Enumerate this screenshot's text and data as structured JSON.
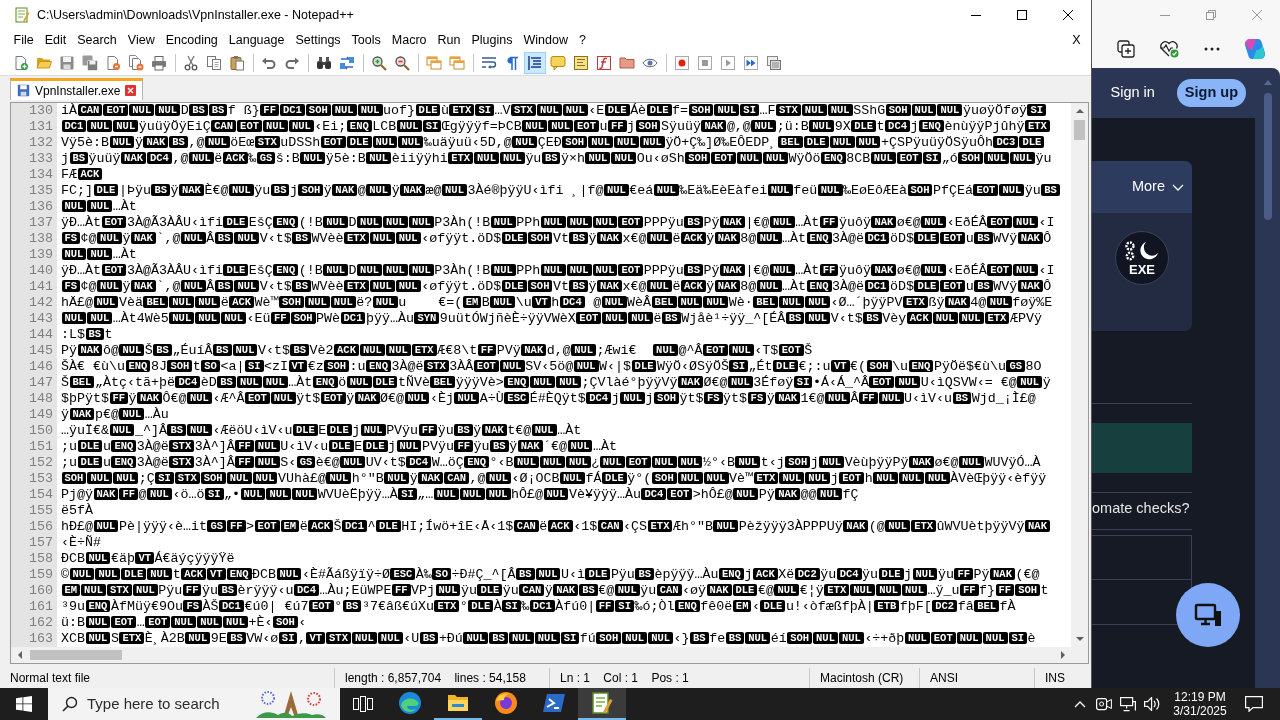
{
  "window": {
    "title": "C:\\Users\\admin\\Downloads\\VpnInstaller.exe - Notepad++"
  },
  "menu": [
    "File",
    "Edit",
    "Search",
    "View",
    "Encoding",
    "Language",
    "Settings",
    "Tools",
    "Macro",
    "Run",
    "Plugins",
    "Window",
    "?"
  ],
  "menu_close": "X",
  "toolbar": [
    [
      {
        "pressed": false
      },
      {
        "pressed": false
      },
      {
        "pressed": false
      },
      {
        "pressed": false
      },
      {
        "pressed": false
      },
      {
        "pressed": false
      },
      {
        "pressed": false
      }
    ],
    [
      {
        "pressed": false
      },
      {
        "pressed": false
      },
      {
        "pressed": false
      }
    ],
    [
      {
        "pressed": false
      },
      {
        "pressed": false
      }
    ],
    [
      {
        "pressed": false
      },
      {
        "pressed": false
      }
    ],
    [
      {
        "pressed": false
      },
      {
        "pressed": false
      }
    ],
    [
      {
        "pressed": false
      },
      {
        "pressed": false
      }
    ],
    [
      {
        "pressed": false
      },
      {
        "pressed": false
      },
      {
        "pressed": true
      },
      {
        "pressed": false
      },
      {
        "pressed": false
      },
      {
        "pressed": false
      },
      {
        "pressed": false
      },
      {
        "pressed": false
      }
    ],
    [
      {
        "pressed": false
      },
      {
        "pressed": false
      },
      {
        "pressed": false
      },
      {
        "pressed": false
      },
      {
        "pressed": false
      }
    ]
  ],
  "tabs": [
    {
      "label": "VpnInstaller.exe",
      "selected": true
    }
  ],
  "editor": {
    "lines": [
      {
        "number": "130",
        "parts": [
          "iÀ",
          [
            "CAN",
            "EOT",
            "NUL",
            "NUL"
          ],
          "D",
          [
            "BS",
            "BS"
          ],
          "f ß}",
          [
            "FF",
            "DC1",
            "SOH",
            "NUL",
            "NUL"
          ],
          "uof}",
          [
            "DLE"
          ],
          "ù",
          [
            "ETX",
            "SI"
          ],
          "…V",
          [
            "STX",
            "NUL",
            "NUL"
          ],
          "‹E",
          [
            "DLE"
          ],
          "Áè",
          [
            "DLE"
          ],
          "f=",
          [
            "SOH",
            "NUL",
            "SI"
          ],
          "…F",
          [
            "STX",
            "NUL",
            "NUL"
          ],
          "SShG",
          [
            "SOH",
            "NUL",
            "NUL"
          ],
          "ÿuøÿÖføÿ",
          [
            "SI"
          ]
        ]
      },
      {
        "number": "131",
        "parts": [
          [
            "DC1",
            "NUL",
            "NUL"
          ],
          "ÿuüÿÖÿEiÇ",
          [
            "CAN",
            "EOT",
            "NUL",
            "NUL"
          ],
          "‹Ei;",
          [
            "ENQ"
          ],
          "LCB",
          [
            "NUL",
            "SI"
          ],
          "Œgÿÿÿf=ÞCB",
          [
            "NUL",
            "NUL",
            "EOT"
          ],
          "u",
          [
            "FF"
          ],
          "j",
          [
            "SOH"
          ],
          "Sÿuüÿ",
          [
            "NAK"
          ],
          "@,@",
          [
            "NUL"
          ],
          ";ü:B",
          [
            "NUL"
          ],
          "9X",
          [
            "DLE"
          ],
          "t",
          [
            "DC4"
          ],
          "j",
          [
            "ENQ"
          ],
          "ènùÿÿPjûhÿ",
          [
            "ETX"
          ]
        ]
      },
      {
        "number": "132",
        "parts": [
          "Vÿ5è:B",
          [
            "NUL"
          ],
          "ÿ",
          [
            "NAK",
            "BS"
          ],
          ",@",
          [
            "NUL"
          ],
          "öEœ",
          [
            "STX"
          ],
          "uDSSh",
          [
            "EOT",
            "DLE",
            "NUL",
            "NUL"
          ],
          "‰uäÿuü‹5D,@",
          [
            "NUL"
          ],
          "ÇEÐ",
          [
            "SOH",
            "NUL",
            "NUL",
            "NUL"
          ],
          "ÿÖ+Ç‰]Ø‰EÔEDP¸",
          [
            "BEL",
            "DLE",
            "NUL",
            "NUL"
          ],
          "+ÇSPÿuüÿÖSÿuÔh",
          [
            "DC3",
            "DLE"
          ]
        ]
      },
      {
        "number": "133",
        "parts": [
          "j",
          [
            "BS"
          ],
          "ÿuüÿ",
          [
            "NAK",
            "DC4"
          ],
          ",@",
          [
            "NUL"
          ],
          "ë",
          [
            "ACK"
          ],
          "‰",
          [
            "GS"
          ],
          "š:B",
          [
            "NUL"
          ],
          "ÿ5è:B",
          [
            "NUL"
          ],
          "èiiÿÿhi",
          [
            "ETX",
            "NUL",
            "NUL"
          ],
          "ÿu",
          [
            "BS"
          ],
          "ÿ×h",
          [
            "NUL",
            "NUL"
          ],
          "Ou‹øSh",
          [
            "SOH",
            "EOT",
            "NUL",
            "NUL"
          ],
          "WÿÖö",
          [
            "ENQ"
          ],
          "8CB",
          [
            "NUL",
            "EOT",
            "SI"
          ],
          "„ó",
          [
            "SOH",
            "NUL",
            "NUL"
          ],
          "ÿu"
        ]
      },
      {
        "number": "134",
        "parts": [
          "FÆ",
          [
            "ACK"
          ]
        ]
      },
      {
        "number": "135",
        "parts": [
          "FC;]",
          [
            "DLE"
          ],
          "|Þÿu",
          [
            "BS"
          ],
          "ÿ",
          [
            "NAK"
          ],
          "È€@",
          [
            "NUL"
          ],
          "ÿu",
          [
            "BS"
          ],
          "j",
          [
            "SOH"
          ],
          "ÿ",
          [
            "NAK"
          ],
          "@",
          [
            "NUL"
          ],
          "ÿ",
          [
            "NAK"
          ],
          "æ@",
          [
            "NUL"
          ],
          "3Àé®þÿÿU‹ìfi ¸|f@",
          [
            "NUL"
          ],
          "€eá",
          [
            "NUL"
          ],
          "‰Eä‰EèEàfei",
          [
            "NUL"
          ],
          "feü",
          [
            "NUL"
          ],
          "‰EøEôÆEà",
          [
            "SOH"
          ],
          "PfÇEá",
          [
            "EOT",
            "NUL"
          ],
          "ÿu",
          [
            "BS"
          ]
        ]
      },
      {
        "number": "136",
        "parts": [
          [
            "NUL",
            "NUL"
          ],
          "…Àt"
        ]
      },
      {
        "number": "137",
        "parts": [
          "ÿÐ…Àt",
          [
            "EOT"
          ],
          "3À@Ã3ÀÂU‹ìfi",
          [
            "DLE"
          ],
          "EšÇ",
          [
            "ENQ"
          ],
          "(!B",
          [
            "NUL"
          ],
          "D",
          [
            "NUL",
            "NUL",
            "NUL"
          ],
          "P3Àh(!B",
          [
            "NUL"
          ],
          "PPh",
          [
            "NUL",
            "NUL",
            "NUL",
            "EOT"
          ],
          "PPPÿu",
          [
            "BS"
          ],
          "Pÿ",
          [
            "NAK"
          ],
          "|€@",
          [
            "NUL"
          ],
          "…Àt",
          [
            "FF"
          ],
          "ÿuôÿ",
          [
            "NAK"
          ],
          "ø€@",
          [
            "NUL"
          ],
          "‹EðÉÂ",
          [
            "EOT",
            "NUL"
          ],
          "‹I"
        ]
      },
      {
        "number": "138",
        "parts": [
          [
            "FS"
          ],
          "¢@",
          [
            "NUL"
          ],
          "ÿ",
          [
            "NAK"
          ],
          "`,@",
          [
            "NUL"
          ],
          "Â",
          [
            "BS",
            "NUL"
          ],
          "V‹t$",
          [
            "BS"
          ],
          "WVèè",
          [
            "ETX",
            "NUL",
            "NUL"
          ],
          "‹øfÿÿt.öD$",
          [
            "DLE",
            "SOH"
          ],
          "Vt",
          [
            "BS"
          ],
          "ÿ",
          [
            "NAK"
          ],
          "x€@",
          [
            "NUL"
          ],
          "ë",
          [
            "ACK"
          ],
          "ÿ",
          [
            "NAK"
          ],
          "8@",
          [
            "NUL"
          ],
          "…Àt",
          [
            "ENQ"
          ],
          "3À@ë",
          [
            "DC1"
          ],
          "öD$",
          [
            "DLE",
            "EOT"
          ],
          "u",
          [
            "BS"
          ],
          "WVÿ",
          [
            "NAK"
          ],
          "Ô"
        ]
      },
      {
        "number": "139",
        "parts": [
          [
            "NUL",
            "NUL"
          ],
          "…Àt"
        ]
      },
      {
        "number": "140",
        "parts": [
          "ÿÐ…Àt",
          [
            "EOT"
          ],
          "3À@Ã3ÀÂU‹ìfi",
          [
            "DLE"
          ],
          "EšÇ",
          [
            "ENQ"
          ],
          "(!B",
          [
            "NUL"
          ],
          "D",
          [
            "NUL",
            "NUL",
            "NUL"
          ],
          "P3Àh(!B",
          [
            "NUL"
          ],
          "PPh",
          [
            "NUL",
            "NUL",
            "NUL",
            "EOT"
          ],
          "PPPÿu",
          [
            "BS"
          ],
          "Pÿ",
          [
            "NAK"
          ],
          "|€@",
          [
            "NUL"
          ],
          "…Àt",
          [
            "FF"
          ],
          "ÿuôÿ",
          [
            "NAK"
          ],
          "ø€@",
          [
            "NUL"
          ],
          "‹EðÉÂ",
          [
            "EOT",
            "NUL"
          ],
          "‹I"
        ]
      },
      {
        "number": "141",
        "parts": [
          [
            "FS"
          ],
          "¢@",
          [
            "NUL"
          ],
          "ÿ",
          [
            "NAK"
          ],
          "`,@",
          [
            "NUL"
          ],
          "Â",
          [
            "BS",
            "NUL"
          ],
          "V‹t$",
          [
            "BS"
          ],
          "WVèè",
          [
            "ETX",
            "NUL",
            "NUL"
          ],
          "‹øfÿÿt.öD$",
          [
            "DLE",
            "SOH"
          ],
          "Vt",
          [
            "BS"
          ],
          "ÿ",
          [
            "NAK"
          ],
          "x€@",
          [
            "NUL"
          ],
          "ë",
          [
            "ACK"
          ],
          "ÿ",
          [
            "NAK"
          ],
          "8@",
          [
            "NUL"
          ],
          "…Àt",
          [
            "ENQ"
          ],
          "3À@ë",
          [
            "DC1"
          ],
          "öD$",
          [
            "DLE",
            "EOT"
          ],
          "u",
          [
            "BS"
          ],
          "WVÿ",
          [
            "NAK"
          ],
          "Ô"
        ]
      },
      {
        "number": "142",
        "parts": [
          "hÄ£@",
          [
            "NUL"
          ],
          "Vèä",
          [
            "BEL",
            "NUL",
            "NUL"
          ],
          "ë",
          [
            "ACK"
          ],
          "Wè™",
          [
            "SOH",
            "NUL",
            "NUL"
          ],
          "ë?",
          [
            "NUL"
          ],
          "u    €=(",
          [
            "EM"
          ],
          "B",
          [
            "NUL"
          ],
          "\\u",
          [
            "VT"
          ],
          "h",
          [
            "DC4"
          ],
          " @",
          [
            "NUL"
          ],
          "WèÂ",
          [
            "BEL",
            "NUL",
            "NUL"
          ],
          "Wè·",
          [
            "BEL",
            "NUL",
            "NUL"
          ],
          "‹Ø…´þÿÿPV",
          [
            "ETX"
          ],
          "ßÿ",
          [
            "NAK"
          ],
          "4@",
          [
            "NUL"
          ],
          "føÿ%E"
        ]
      },
      {
        "number": "143",
        "parts": [
          [
            "NUL",
            "NUL"
          ],
          "…Àt4Wè5",
          [
            "NUL",
            "NUL",
            "NUL"
          ],
          "‹Eü",
          [
            "FF",
            "SOH"
          ],
          "PWè",
          [
            "DC1"
          ],
          "þÿÿ…Àu",
          [
            "SYN"
          ],
          "9uütÓWjñèÈ÷ÿÿVWèX",
          [
            "EOT",
            "NUL",
            "NUL"
          ],
          "ë",
          [
            "BS"
          ],
          "Wjåè¹÷ÿÿ_^[ÉÂ",
          [
            "BS",
            "NUL"
          ],
          "V‹t$",
          [
            "BS"
          ],
          "Vèy",
          [
            "ACK",
            "NUL",
            "NUL",
            "ETX"
          ],
          "ÆPVÿ"
        ]
      },
      {
        "number": "144",
        "parts": [
          ":L$",
          [
            "BS"
          ],
          "t"
        ]
      },
      {
        "number": "145",
        "parts": [
          "Pÿ",
          [
            "NAK"
          ],
          "ô@",
          [
            "NUL"
          ],
          "Š",
          [
            "BS"
          ],
          "„ÉuíÂ",
          [
            "BS",
            "NUL"
          ],
          "V‹t$",
          [
            "BS"
          ],
          "Vè2",
          [
            "ACK",
            "NUL",
            "NUL",
            "ETX"
          ],
          "Æ€8\\t",
          [
            "FF"
          ],
          "PVÿ",
          [
            "NAK"
          ],
          "d,@",
          [
            "NUL"
          ],
          ";Æwi€  ",
          [
            "NUL"
          ],
          "@^Â",
          [
            "EOT",
            "NUL"
          ],
          "‹T$",
          [
            "EOT"
          ],
          "Š"
        ]
      },
      {
        "number": "146",
        "parts": [
          "ŠÀ€ €ù\\u",
          [
            "ENQ"
          ],
          "8J",
          [
            "SOH"
          ],
          "t",
          [
            "SO"
          ],
          "<a|",
          [
            "SI"
          ],
          "<zI",
          [
            "VT"
          ],
          "€z",
          [
            "SOH"
          ],
          ":u",
          [
            "ENQ"
          ],
          "3À@ë",
          [
            "STX"
          ],
          "3ÀÂ",
          [
            "EOT",
            "NUL"
          ],
          "SV‹5ö@",
          [
            "NUL"
          ],
          "W‹|$",
          [
            "DLE"
          ],
          "WÿÖ‹ØSÿÖŠ",
          [
            "SI"
          ],
          "„Ét",
          [
            "DLE"
          ],
          "€;:u",
          [
            "VT"
          ],
          "€(",
          [
            "SOH"
          ],
          "\\u",
          [
            "ENQ"
          ],
          "PÿÖë$€ù\\u",
          [
            "GS"
          ],
          "8O"
        ]
      },
      {
        "number": "147",
        "parts": [
          "Š",
          [
            "BEL"
          ],
          "„Àtç‹tã+þë",
          [
            "DC4"
          ],
          "èD",
          [
            "BS",
            "NUL",
            "NUL"
          ],
          "…Àt",
          [
            "ENQ"
          ],
          "ö",
          [
            "NUL",
            "DLE"
          ],
          "tÑVè",
          [
            "BEL"
          ],
          "ÿÿÿVè>",
          [
            "ENQ",
            "NUL",
            "NUL"
          ],
          ";ÇVlàé°þÿÿVÿ",
          [
            "NAK"
          ],
          "Ø€@",
          [
            "NUL"
          ],
          "3Éføÿ",
          [
            "SI"
          ],
          "•Á‹Á_^Â",
          [
            "EOT",
            "NUL"
          ],
          "U‹ìQSVW‹= €@",
          [
            "NUL"
          ],
          "ÿ"
        ]
      },
      {
        "number": "148",
        "parts": [
          "$þPÿt$",
          [
            "FF"
          ],
          "ÿ",
          [
            "NAK"
          ],
          "Ô€@",
          [
            "NUL"
          ],
          "‹Æ^Â",
          [
            "EOT",
            "NUL"
          ],
          "ÿt$",
          [
            "EOT"
          ],
          "ÿ",
          [
            "NAK"
          ],
          "Ø€@",
          [
            "NUL"
          ],
          "‹Èj",
          [
            "NUL"
          ],
          "A÷Ù",
          [
            "ESC"
          ],
          "É#ÈQÿt$",
          [
            "DC4"
          ],
          "j",
          [
            "NUL"
          ],
          "j",
          [
            "SOH"
          ],
          "ÿt$",
          [
            "FS"
          ],
          "ÿt$",
          [
            "FS"
          ],
          "ÿ",
          [
            "NAK"
          ],
          "1€@",
          [
            "NUL"
          ],
          "Â",
          [
            "FF",
            "NUL"
          ],
          "U‹ìV‹u",
          [
            "BS"
          ],
          "Wjd_¡Ì£@"
        ]
      },
      {
        "number": "149",
        "parts": [
          "ÿ",
          [
            "NAK"
          ],
          "p€@",
          [
            "NUL"
          ],
          "…Àu"
        ]
      },
      {
        "number": "150",
        "parts": [
          "…ÿuÏ€&",
          [
            "NUL"
          ],
          "_^]Â",
          [
            "BS",
            "NUL"
          ],
          "‹ÆëöU‹ìV‹u",
          [
            "DLE"
          ],
          "E",
          [
            "DLE"
          ],
          "j",
          [
            "NUL"
          ],
          "PVÿu",
          [
            "FF"
          ],
          "ÿu",
          [
            "BS"
          ],
          "ÿ",
          [
            "NAK"
          ],
          "t€@",
          [
            "NUL"
          ],
          "…Àt"
        ]
      },
      {
        "number": "151",
        "parts": [
          ";u",
          [
            "DLE"
          ],
          "u",
          [
            "ENQ"
          ],
          "3À@ë",
          [
            "STX"
          ],
          "3À^]Â",
          [
            "FF",
            "NUL"
          ],
          "U‹ìV‹u",
          [
            "DLE"
          ],
          "E",
          [
            "DLE"
          ],
          "j",
          [
            "NUL"
          ],
          "PVÿu",
          [
            "FF"
          ],
          "ÿu",
          [
            "BS"
          ],
          "ÿ",
          [
            "NAK"
          ],
          "´€@",
          [
            "NUL"
          ],
          "…Àt"
        ]
      },
      {
        "number": "152",
        "parts": [
          ";u",
          [
            "DLE"
          ],
          "u",
          [
            "ENQ"
          ],
          "3À@ë",
          [
            "STX"
          ],
          "3À^]Â",
          [
            "FF",
            "NUL"
          ],
          "S‹",
          [
            "GS"
          ],
          "è€@",
          [
            "NUL"
          ],
          "UV‹t$",
          [
            "DC4"
          ],
          "W…öÇ",
          [
            "ENQ"
          ],
          "°‹B",
          [
            "NUL",
            "NUL",
            "NUL"
          ],
          "¿",
          [
            "NUL",
            "EOT",
            "NUL",
            "NUL"
          ],
          "½°‹B",
          [
            "NUL"
          ],
          "t‹j",
          [
            "SOH"
          ],
          "j",
          [
            "NUL"
          ],
          "VèùþÿÿPÿ",
          [
            "NAK"
          ],
          "ø€@",
          [
            "NUL"
          ],
          "WUVÿÓ…À"
        ]
      },
      {
        "number": "153",
        "parts": [
          [
            "SOH",
            "NUL",
            "NUL"
          ],
          ";Ç",
          [
            "SI",
            "STX",
            "SOH",
            "NUL",
            "NUL"
          ],
          "VUhà£@",
          [
            "NUL"
          ],
          "h°\"B",
          [
            "NUL"
          ],
          "ÿ",
          [
            "NAK",
            "CAN"
          ],
          ",@",
          [
            "NUL"
          ],
          "‹Ø¡OCB",
          [
            "NUL"
          ],
          "fÁ",
          [
            "DLE"
          ],
          "ÿ°(",
          [
            "SOH",
            "NUL",
            "NUL"
          ],
          "Vè™",
          [
            "ETX",
            "NUL",
            "NUL"
          ],
          "j",
          [
            "EOT"
          ],
          "h",
          [
            "NUL",
            "NUL",
            "NUL"
          ],
          "ÀVèŒþÿÿ‹èfÿÿ"
        ]
      },
      {
        "number": "154",
        "parts": [
          "Pj@ÿ",
          [
            "NAK",
            "FF"
          ],
          "@",
          [
            "NUL"
          ],
          "‹ö…ö",
          [
            "SI"
          ],
          "„•",
          [
            "NUL",
            "NUL",
            "NUL"
          ],
          "WVUèËþÿÿ…À",
          [
            "SI"
          ],
          "„…",
          [
            "NUL",
            "NUL",
            "NUL"
          ],
          "hÔ£@",
          [
            "NUL"
          ],
          "Vè¥ÿÿÿ…Àu",
          [
            "DC4",
            "EOT"
          ],
          ">hÔ£@",
          [
            "NUL"
          ],
          "Pÿ",
          [
            "NAK"
          ],
          "@@",
          [
            "NUL"
          ],
          "fÇ"
        ]
      },
      {
        "number": "155",
        "parts": [
          "ë5fÀ"
        ]
      },
      {
        "number": "156",
        "parts": [
          "hÐ£@",
          [
            "NUL"
          ],
          "Pè|ÿÿÿ‹è…it",
          [
            "GS",
            "FF"
          ],
          ">",
          [
            "EOT",
            "EM"
          ],
          "ë",
          [
            "ACK"
          ],
          "Š",
          [
            "DC1"
          ],
          "^",
          [
            "DLE"
          ],
          "HI;Íwö+îE‹Å‹1$",
          [
            "CAN"
          ],
          "ë",
          [
            "ACK"
          ],
          "‹1$",
          [
            "CAN"
          ],
          "‹ÇS",
          [
            "ETX"
          ],
          "Æh°\"B",
          [
            "NUL"
          ],
          "Pèžÿÿÿ3ÀPPPUÿ",
          [
            "NAK"
          ],
          "(@",
          [
            "NUL",
            "ETX"
          ],
          "ûWVUètþÿÿVÿ",
          [
            "NAK"
          ]
        ]
      },
      {
        "number": "157",
        "parts": [
          "‹È÷Ñ#"
        ]
      },
      {
        "number": "158",
        "parts": [
          "ÐCB",
          [
            "NUL"
          ],
          "€äþ",
          [
            "VT"
          ],
          "Á€äýçÿÿÿŸë"
        ]
      },
      {
        "number": "159",
        "parts": [
          "©",
          [
            "NUL",
            "NUL",
            "DLE",
            "NUL"
          ],
          "t",
          [
            "ACK",
            "VT",
            "ENQ"
          ],
          "ÐCB",
          [
            "NUL"
          ],
          "‹È#Ãáßÿïÿ÷Ø",
          [
            "ESC"
          ],
          "À‰",
          [
            "SO"
          ],
          "÷Ð#Ç_^[Â",
          [
            "BS",
            "NUL"
          ],
          "U‹ì",
          [
            "DLE"
          ],
          "Pÿu",
          [
            "BS"
          ],
          "èpÿÿÿ…Àu",
          [
            "ENQ"
          ],
          "j",
          [
            "ACK"
          ],
          "Xë",
          [
            "DC2"
          ],
          "ÿu",
          [
            "DC4"
          ],
          "ÿu",
          [
            "DLE"
          ],
          "j",
          [
            "NUL"
          ],
          "ÿu",
          [
            "FF"
          ],
          "Pÿ",
          [
            "NAK"
          ],
          "(€@"
        ]
      },
      {
        "number": "160",
        "parts": [
          [
            "EM",
            "NUL",
            "STX",
            "NUL"
          ],
          "Pÿu",
          [
            "FF"
          ],
          "ÿu",
          [
            "BS"
          ],
          "èrÿÿÿ‹u",
          [
            "DC4"
          ],
          "…Àu;EüWPE",
          [
            "FF"
          ],
          "VPj",
          [
            "NUL"
          ],
          "ÿu",
          [
            "DLE"
          ],
          "ÿu",
          [
            "CAN"
          ],
          "ÿ",
          [
            "NAK",
            "BS"
          ],
          "€@",
          [
            "NUL"
          ],
          "ÿu",
          [
            "CAN"
          ],
          "‹øÿ",
          [
            "NAK",
            "DLE"
          ],
          "€@",
          [
            "NUL"
          ],
          "€¦ÿ",
          [
            "ETX",
            "NUL",
            "NUL",
            "NUL"
          ],
          "…ÿ_u",
          [
            "FF"
          ],
          "f}",
          [
            "FF",
            "SOH"
          ],
          "t"
        ]
      },
      {
        "number": "161",
        "parts": [
          "³9u",
          [
            "ENQ"
          ],
          "ÀfMüÿ€9Ou",
          [
            "FS"
          ],
          "ÀŠ",
          [
            "DC1"
          ],
          "€ú0| €ú7",
          [
            "EOT"
          ],
          "°",
          [
            "BS"
          ],
          "³7€âß€úXu",
          [
            "ETX"
          ],
          "°",
          [
            "DLE"
          ],
          "À",
          [
            "SI"
          ],
          "‰",
          [
            "DC1"
          ],
          "Àfú0|",
          [
            "FF",
            "SI"
          ],
          "‰ó;Òl",
          [
            "ENQ"
          ],
          "fê0ë",
          [
            "EM"
          ],
          "‹",
          [
            "DLE"
          ],
          "u!‹òfæßfþÀ|",
          [
            "ETB"
          ],
          "fþF[",
          [
            "DC2"
          ],
          "fâ",
          [
            "BEL"
          ],
          "fÀ"
        ]
      },
      {
        "number": "162",
        "parts": [
          "ü:B",
          [
            "NUL",
            "EOT"
          ],
          "…",
          [
            "EOT",
            "NUL",
            "NUL",
            "NUL"
          ],
          "+È‹",
          [
            "SOH"
          ],
          "‹"
        ]
      },
      {
        "number": "163",
        "parts": [
          "XCB",
          [
            "NUL"
          ],
          "S",
          [
            "ETX"
          ],
          "È¸À2B",
          [
            "NUL"
          ],
          "9E",
          [
            "BS"
          ],
          "VW‹ø",
          [
            "SI"
          ],
          ",",
          [
            "VT",
            "STX",
            "NUL",
            "NUL"
          ],
          "‹U",
          [
            "BS"
          ],
          "+Ðú",
          [
            "NUL",
            "BS",
            "NUL",
            "NUL",
            "SI"
          ],
          "fú",
          [
            "SOH",
            "NUL",
            "NUL"
          ],
          "‹}",
          [
            "BS"
          ],
          "fe",
          [
            "BS",
            "NUL"
          ],
          "éí",
          [
            "SOH",
            "NUL",
            "NUL"
          ],
          "‹÷+ðþ",
          [
            "NUL",
            "EOT",
            "NUL",
            "NUL",
            "SI"
          ],
          "è"
        ]
      }
    ]
  },
  "status_bar": [
    "Normal text file",
    "length : 6,857,704    lines : 54,158",
    "Ln : 1    Col : 1    Pos : 1",
    "Macintosh (CR)",
    "ANSI",
    "INS"
  ],
  "browser": {
    "sign_in": "Sign in",
    "sign_up": "Sign up",
    "more": "More",
    "file_badge": "EXE",
    "question": "omate checks?"
  },
  "taskbar": {
    "search": {
      "placeholder": "Type here to search"
    },
    "apps": [
      {
        "running": false,
        "selected": false
      },
      {
        "running": true,
        "selected": false
      },
      {
        "running": false,
        "selected": false
      },
      {
        "running": false,
        "selected": false
      },
      {
        "running": true,
        "selected": true
      }
    ],
    "time": "12:19 PM",
    "date": "3/31/2025"
  }
}
